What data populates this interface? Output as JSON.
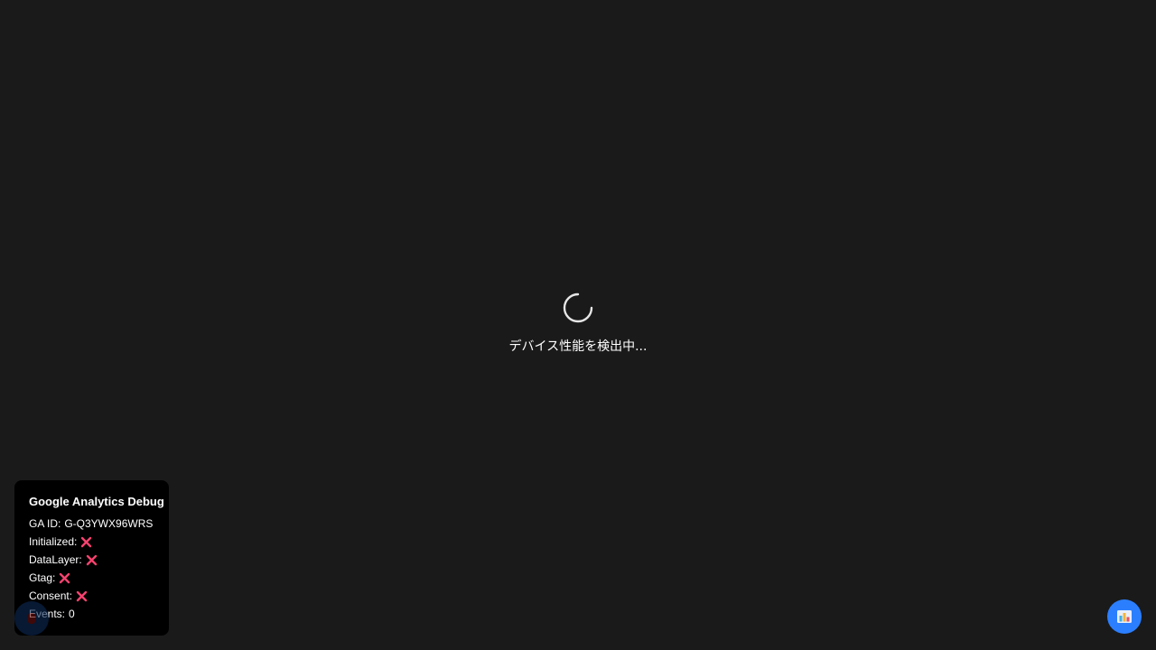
{
  "loader": {
    "text": "デバイス性能を検出中..."
  },
  "debug_panel": {
    "title": "Google Analytics Debug",
    "rows": [
      {
        "label": "GA ID:",
        "value": "G-Q3YWX96WRS"
      },
      {
        "label": "Initialized:",
        "status": "fail"
      },
      {
        "label": "DataLayer:",
        "status": "fail"
      },
      {
        "label": "Gtag:",
        "status": "fail"
      },
      {
        "label": "Consent:",
        "status": "fail"
      },
      {
        "label": "Events:",
        "value": "0"
      }
    ]
  },
  "colors": {
    "background": "#1a1a1a",
    "fail_mark": "#f7426f",
    "fab_accent": "#2b7fff"
  },
  "icons": {
    "spinner": "loading-spinner-icon",
    "fail": "x-mark-icon",
    "fab_right": "bar-chart-icon"
  }
}
